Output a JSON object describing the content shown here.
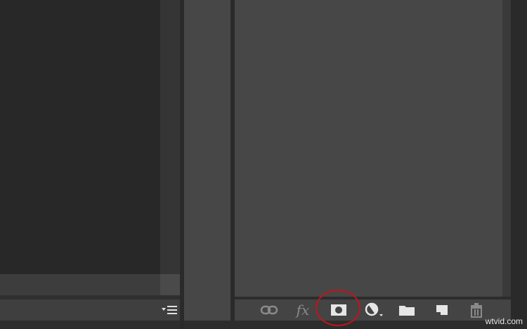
{
  "left_panel": {
    "menu_icon": "panel-menu-icon"
  },
  "layers_panel": {
    "toolbar_buttons": [
      {
        "name": "link-layers",
        "icon": "link-icon"
      },
      {
        "name": "layer-style",
        "icon": "fx-icon",
        "label": "fx"
      },
      {
        "name": "add-layer-mask",
        "icon": "mask-icon"
      },
      {
        "name": "new-adjustment-layer",
        "icon": "adjustment-icon"
      },
      {
        "name": "new-group",
        "icon": "folder-icon"
      },
      {
        "name": "new-layer",
        "icon": "new-layer-icon"
      },
      {
        "name": "delete-layer",
        "icon": "trash-icon"
      }
    ],
    "highlight_color": "#c0151c"
  },
  "watermark": "wtvid.com"
}
